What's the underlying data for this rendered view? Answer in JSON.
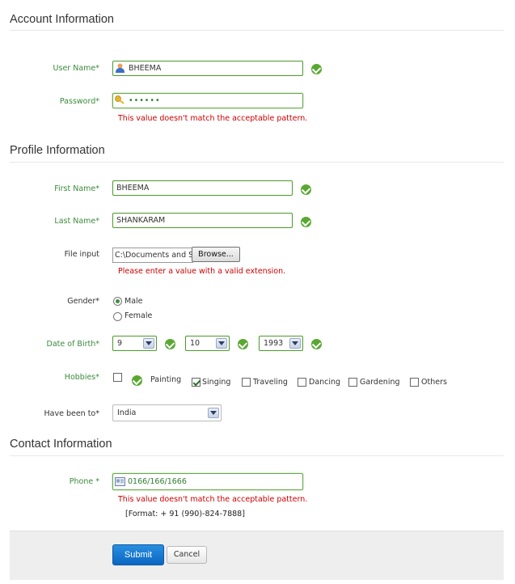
{
  "account": {
    "title": "Account Information",
    "username_label": "User Name*",
    "username_value": "BHEEMA",
    "password_label": "Password*",
    "password_value": "••••••",
    "password_error": "This value doesn't match the acceptable pattern."
  },
  "profile": {
    "title": "Profile Information",
    "first_name_label": "First Name*",
    "first_name_value": "BHEEMA",
    "last_name_label": "Last Name*",
    "last_name_value": "SHANKARAM",
    "file_label": "File input",
    "file_value": "C:\\Documents and S",
    "browse_label": "Browse...",
    "file_error": "Please enter a value with a valid extension.",
    "gender_label": "Gender*",
    "gender_male": "Male",
    "gender_female": "Female",
    "dob_label": "Date of Birth*",
    "dob_day": "9",
    "dob_month": "10",
    "dob_year": "1993",
    "hobbies_label": "Hobbies*",
    "hobbies": [
      "Painting",
      "Singing",
      "Traveling",
      "Dancing",
      "Gardening",
      "Others"
    ],
    "been_to_label": "Have been to*",
    "been_to_value": "India"
  },
  "contact": {
    "title": "Contact Information",
    "phone_label": "Phone *",
    "phone_value": "0166/166/1666",
    "phone_error": "This value doesn't match the acceptable pattern.",
    "phone_format": "[Format: + 91 (990)-824-7888]"
  },
  "actions": {
    "submit": "Submit",
    "cancel": "Cancel"
  },
  "colors": {
    "valid": "#5aa832",
    "error": "#cc0000",
    "primary": "#0a66c2"
  }
}
